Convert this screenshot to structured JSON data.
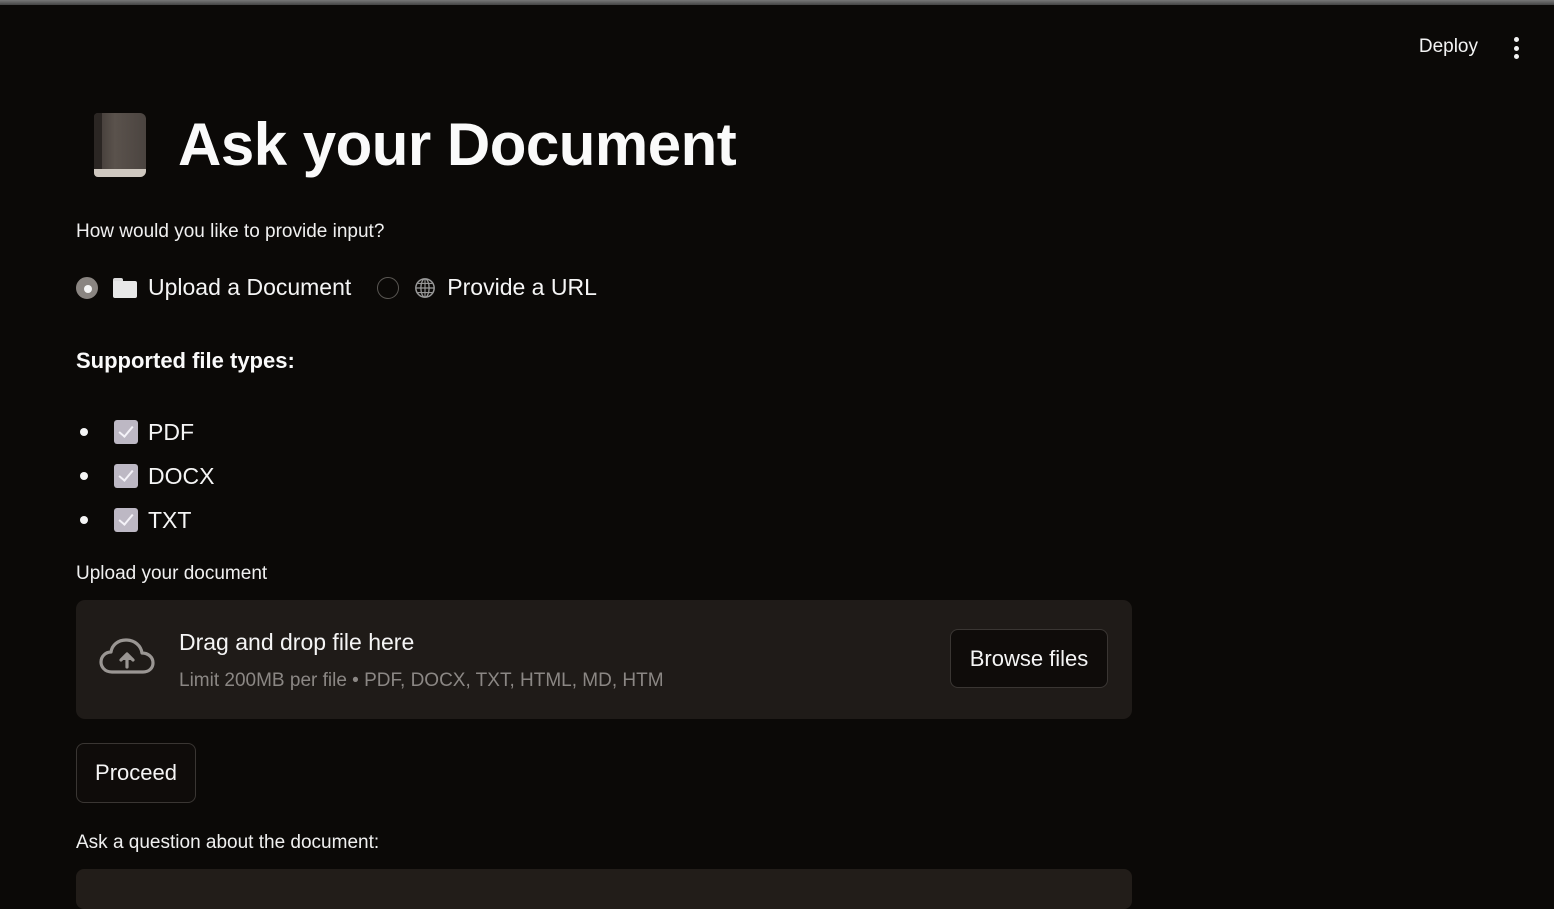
{
  "header": {
    "deploy_label": "Deploy"
  },
  "page": {
    "title": "Ask your Document",
    "title_icon": "book-icon"
  },
  "input_mode": {
    "question": "How would you like to provide input?",
    "options": [
      {
        "label": "Upload a Document",
        "icon": "folder-icon",
        "selected": true
      },
      {
        "label": "Provide a URL",
        "icon": "globe-icon",
        "selected": false
      }
    ]
  },
  "supported": {
    "heading": "Supported file types:",
    "types": [
      "PDF",
      "DOCX",
      "TXT"
    ]
  },
  "uploader": {
    "label": "Upload your document",
    "drop_title": "Drag and drop file here",
    "limit_text": "Limit 200MB per file • PDF, DOCX, TXT, HTML, MD, HTM",
    "browse_label": "Browse files"
  },
  "proceed_label": "Proceed",
  "question": {
    "label": "Ask a question about the document:",
    "value": ""
  },
  "colors": {
    "background": "#0b0907",
    "panel": "#1f1b18",
    "text": "#fafafa",
    "muted": "#8b8784"
  }
}
